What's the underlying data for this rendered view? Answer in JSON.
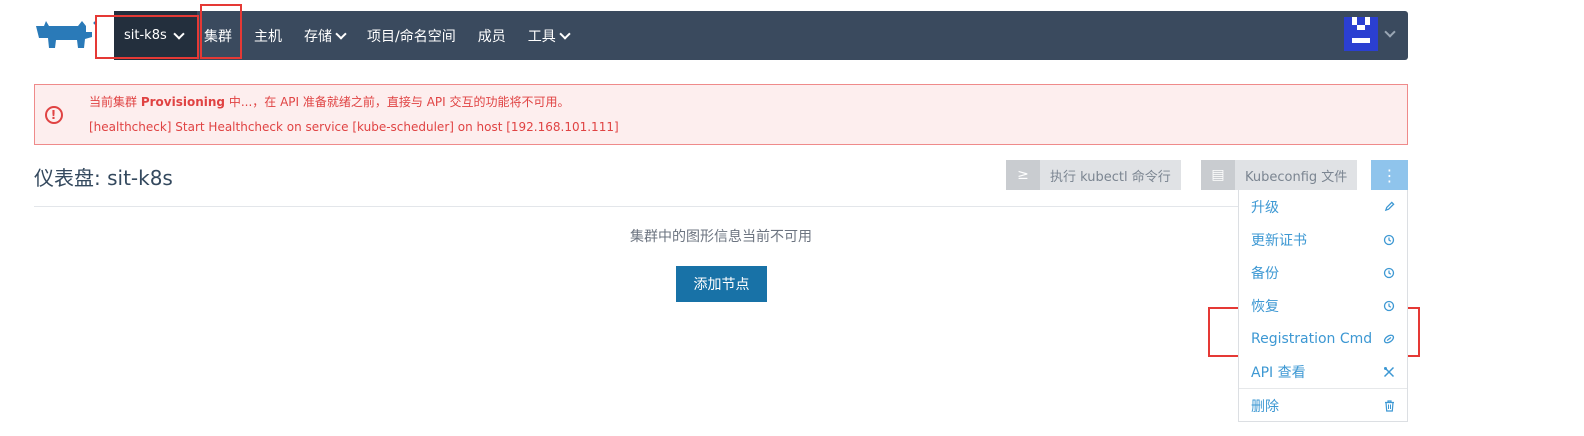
{
  "nav": {
    "cluster": "sit-k8s",
    "items": [
      {
        "label": "集群"
      },
      {
        "label": "主机"
      },
      {
        "label": "存储"
      },
      {
        "label": "项目/命名空间"
      },
      {
        "label": "成员"
      },
      {
        "label": "工具"
      }
    ]
  },
  "alert": {
    "line1_prefix": "当前集群 ",
    "line1_strong": "Provisioning",
    "line1_suffix": " 中...，在 API 准备就绪之前，直接与 API 交互的功能将不可用。",
    "line2": "[healthcheck] Start Healthcheck on service [kube-scheduler] on host [192.168.101.111]",
    "icon": "info-circle-icon"
  },
  "page": {
    "title": "仪表盘: sit-k8s",
    "empty_message": "集群中的图形信息当前不可用",
    "add_node_label": "添加节点"
  },
  "toolbar": {
    "kubectl_label": "执行 kubectl 命令行",
    "kubeconfig_label": "Kubeconfig 文件",
    "more_label": "⋮"
  },
  "menu": {
    "items": [
      {
        "label": "升级",
        "icon": "pencil-icon"
      },
      {
        "label": "更新证书",
        "icon": "history-icon"
      },
      {
        "label": "备份",
        "icon": "history-icon"
      },
      {
        "label": "恢复",
        "icon": "history-icon"
      },
      {
        "label": "Registration Cmd",
        "icon": "link-icon"
      },
      {
        "label": "API 查看",
        "icon": "tools-icon"
      },
      {
        "label": "删除",
        "icon": "trash-icon"
      }
    ]
  },
  "colors": {
    "navbar": "#3a4a5e",
    "accent": "#1872a7",
    "link": "#3d98d3",
    "error": "#e04343"
  }
}
